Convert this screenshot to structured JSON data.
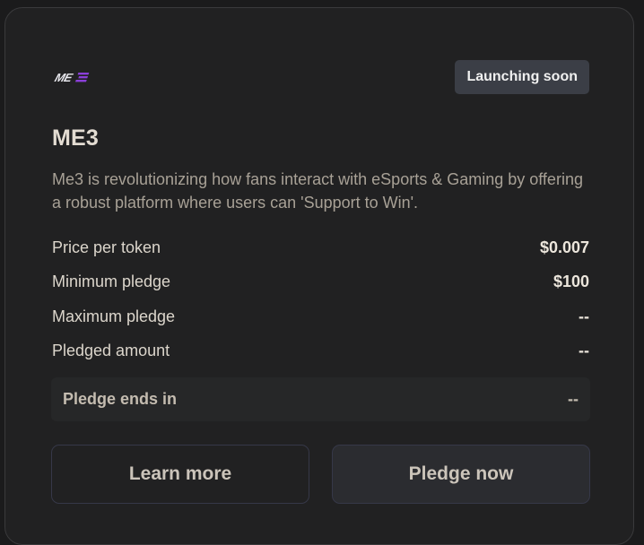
{
  "project": {
    "logo_text": "ME3",
    "status_badge": "Launching soon",
    "name": "ME3",
    "description": "Me3 is revolutionizing how fans interact with eSports & Gaming by offering a robust platform where users can 'Support to Win'."
  },
  "details": [
    {
      "label": "Price per token",
      "value": "$0.007"
    },
    {
      "label": "Minimum pledge",
      "value": "$100"
    },
    {
      "label": "Maximum pledge",
      "value": "--"
    },
    {
      "label": "Pledged amount",
      "value": "--"
    }
  ],
  "pledge_ends": {
    "label": "Pledge ends in",
    "value": "--"
  },
  "actions": {
    "learn_more": "Learn more",
    "pledge_now": "Pledge now"
  },
  "colors": {
    "logo_white": "#e8e8ee",
    "logo_accent": "#8b3fd9",
    "badge_bg": "#3b3e46"
  }
}
